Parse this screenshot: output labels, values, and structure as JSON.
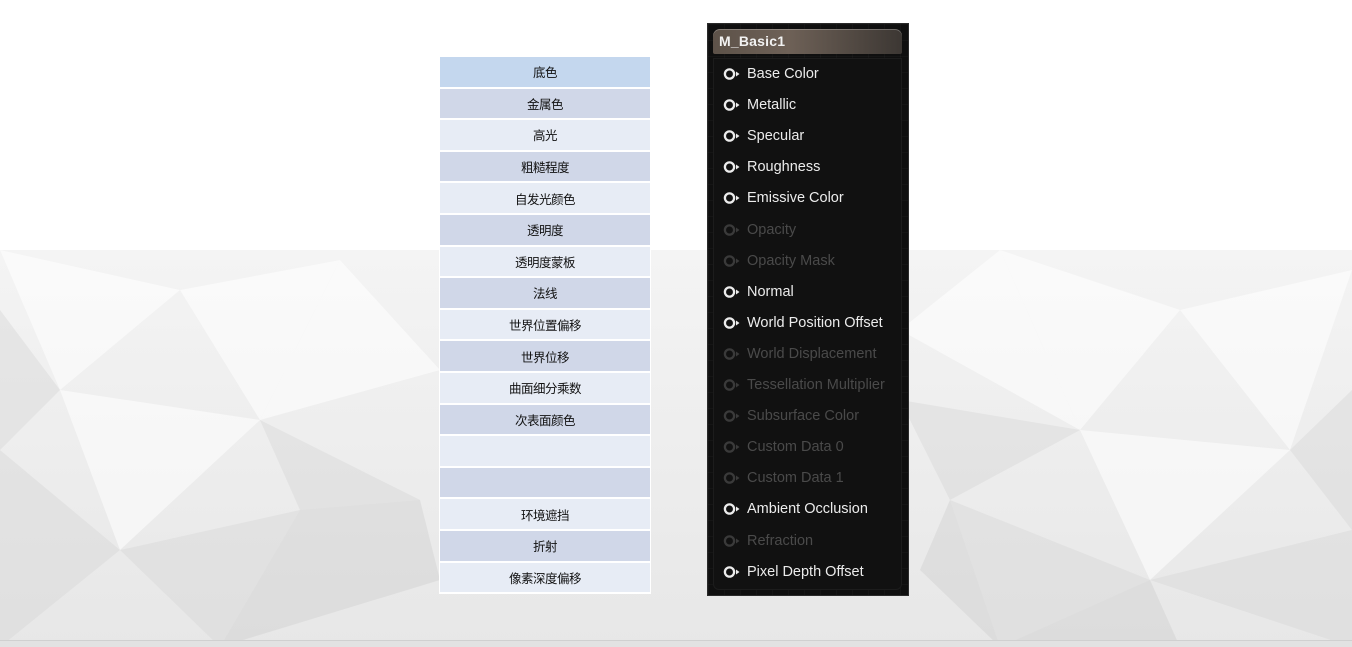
{
  "cn_table": {
    "rows": [
      {
        "text": "底色",
        "style": "first"
      },
      {
        "text": "金属色",
        "style": "dark"
      },
      {
        "text": "高光",
        "style": "light"
      },
      {
        "text": "粗糙程度",
        "style": "dark"
      },
      {
        "text": "自发光颜色",
        "style": "light"
      },
      {
        "text": "透明度",
        "style": "dark"
      },
      {
        "text": "透明度蒙板",
        "style": "light"
      },
      {
        "text": "法线",
        "style": "dark"
      },
      {
        "text": "世界位置偏移",
        "style": "light"
      },
      {
        "text": "世界位移",
        "style": "dark"
      },
      {
        "text": "曲面细分乘数",
        "style": "light"
      },
      {
        "text": "次表面颜色",
        "style": "dark"
      },
      {
        "text": "",
        "style": "light"
      },
      {
        "text": "",
        "style": "dark"
      },
      {
        "text": "环境遮挡",
        "style": "light"
      },
      {
        "text": "折射",
        "style": "dark"
      },
      {
        "text": "像素深度偏移",
        "style": "light"
      }
    ]
  },
  "material_node": {
    "title": "M_Basic1",
    "pins": [
      {
        "label": "Base Color",
        "enabled": true
      },
      {
        "label": "Metallic",
        "enabled": true
      },
      {
        "label": "Specular",
        "enabled": true
      },
      {
        "label": "Roughness",
        "enabled": true
      },
      {
        "label": "Emissive Color",
        "enabled": true
      },
      {
        "label": "Opacity",
        "enabled": false
      },
      {
        "label": "Opacity Mask",
        "enabled": false
      },
      {
        "label": "Normal",
        "enabled": true
      },
      {
        "label": "World Position Offset",
        "enabled": true
      },
      {
        "label": "World Displacement",
        "enabled": false
      },
      {
        "label": "Tessellation Multiplier",
        "enabled": false
      },
      {
        "label": "Subsurface Color",
        "enabled": false
      },
      {
        "label": "Custom Data 0",
        "enabled": false
      },
      {
        "label": "Custom Data 1",
        "enabled": false
      },
      {
        "label": "Ambient Occlusion",
        "enabled": true
      },
      {
        "label": "Refraction",
        "enabled": false
      },
      {
        "label": "Pixel Depth Offset",
        "enabled": true
      }
    ]
  },
  "colors": {
    "pin_enabled": "#ececec",
    "pin_disabled": "#4a4a4a",
    "header_brown": "#6e6157",
    "table_first": "#c4d7ee",
    "table_dark": "#d0d7e8",
    "table_light": "#e7ecf5"
  },
  "icons": {
    "pin": "pin-circle-arrow-icon"
  }
}
